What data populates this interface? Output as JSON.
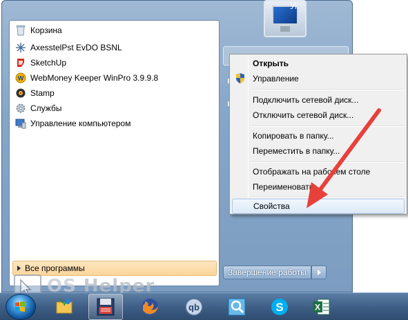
{
  "user": {
    "name": "Ук"
  },
  "programs": [
    {
      "label": "Корзина",
      "icon": "recycle-bin-icon"
    },
    {
      "label": "AxesstelPst EvDO BSNL",
      "icon": "network-icon"
    },
    {
      "label": "SketchUp",
      "icon": "sketchup-icon"
    },
    {
      "label": "WebMoney Keeper WinPro 3.9.9.8",
      "icon": "webmoney-icon"
    },
    {
      "label": "Stamp",
      "icon": "stamp-icon"
    },
    {
      "label": "Службы",
      "icon": "services-gear-icon"
    },
    {
      "label": "Управление компьютером",
      "icon": "computer-management-icon"
    }
  ],
  "all_programs": {
    "label": "Все программы"
  },
  "shutdown": {
    "label": "Завершение работы"
  },
  "context_menu": {
    "items": [
      {
        "label": "Открыть",
        "bold": true
      },
      {
        "label": "Управление",
        "icon": "uac-shield-icon"
      },
      {
        "label": "Подключить сетевой диск..."
      },
      {
        "label": "Отключить сетевой диск..."
      },
      {
        "label": "Копировать в папку..."
      },
      {
        "label": "Переместить в папку..."
      },
      {
        "label": "Отображать на рабочем столе"
      },
      {
        "label": "Переименовать"
      },
      {
        "label": "Свойства",
        "selected": true
      }
    ]
  },
  "taskbar": {
    "items": [
      {
        "name": "windows-explorer",
        "icon": "explorer-icon"
      },
      {
        "name": "save-app",
        "icon": "floppy-disk-icon",
        "active": true
      },
      {
        "name": "firefox",
        "icon": "firefox-icon"
      },
      {
        "name": "qbittorrent",
        "icon": "qbittorrent-icon"
      },
      {
        "name": "search-tool",
        "icon": "magnifier-icon"
      },
      {
        "name": "skype",
        "icon": "skype-icon"
      },
      {
        "name": "excel",
        "icon": "excel-icon"
      }
    ]
  },
  "watermark": {
    "os": "OS",
    "helper": "Helper"
  },
  "colors": {
    "arrow": "#e8403a",
    "menu_highlight": "#dbe9f8",
    "taskbar": "#3f5f86"
  }
}
